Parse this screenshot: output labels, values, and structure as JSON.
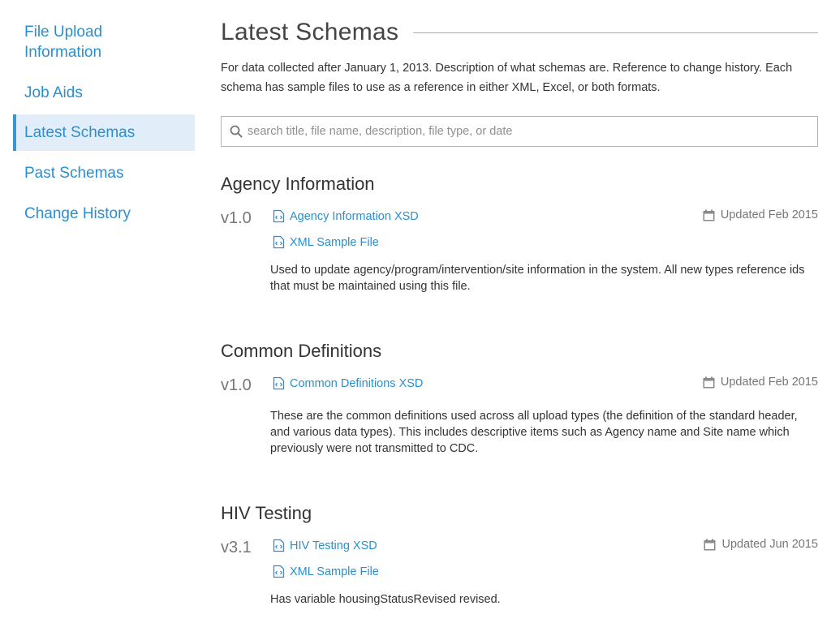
{
  "sidebar": {
    "items": [
      {
        "label": "File Upload Information",
        "active": false
      },
      {
        "label": "Job Aids",
        "active": false
      },
      {
        "label": "Latest Schemas",
        "active": true
      },
      {
        "label": "Past Schemas",
        "active": false
      },
      {
        "label": "Change History",
        "active": false
      }
    ]
  },
  "main": {
    "title": "Latest Schemas",
    "intro": "For data collected after January 1, 2013. Description of what schemas are. Reference to change history. Each schema has sample files to use as a reference in either XML, Excel, or both formats.",
    "search": {
      "placeholder": "search title, file name, description, file type, or date",
      "value": ""
    },
    "schemas": [
      {
        "title": "Agency Information",
        "version": "v1.0",
        "links": [
          "Agency Information XSD",
          "XML Sample File"
        ],
        "updated": "Updated Feb 2015",
        "description": "Used to update agency/program/intervention/site information in the system. All new types reference ids that must be maintained using this file."
      },
      {
        "title": "Common Definitions",
        "version": "v1.0",
        "links": [
          "Common Definitions XSD"
        ],
        "updated": "Updated Feb 2015",
        "description": "These are the common definitions used across all upload types (the definition of the standard header, and various data types). This includes descriptive items such as Agency name and Site name which previously were not transmitted to CDC."
      },
      {
        "title": "HIV Testing",
        "version": "v3.1",
        "links": [
          "HIV Testing XSD",
          "XML Sample File"
        ],
        "updated": "Updated Jun 2015",
        "description": "Has variable housingStatusRevised revised."
      }
    ]
  },
  "icons": {
    "search": "search-icon",
    "file": "code-file-icon",
    "calendar": "calendar-icon"
  },
  "colors": {
    "link": "#2a8fd0",
    "active_bg": "#e1eef9",
    "active_border": "#3a95d6",
    "muted": "#777777"
  }
}
